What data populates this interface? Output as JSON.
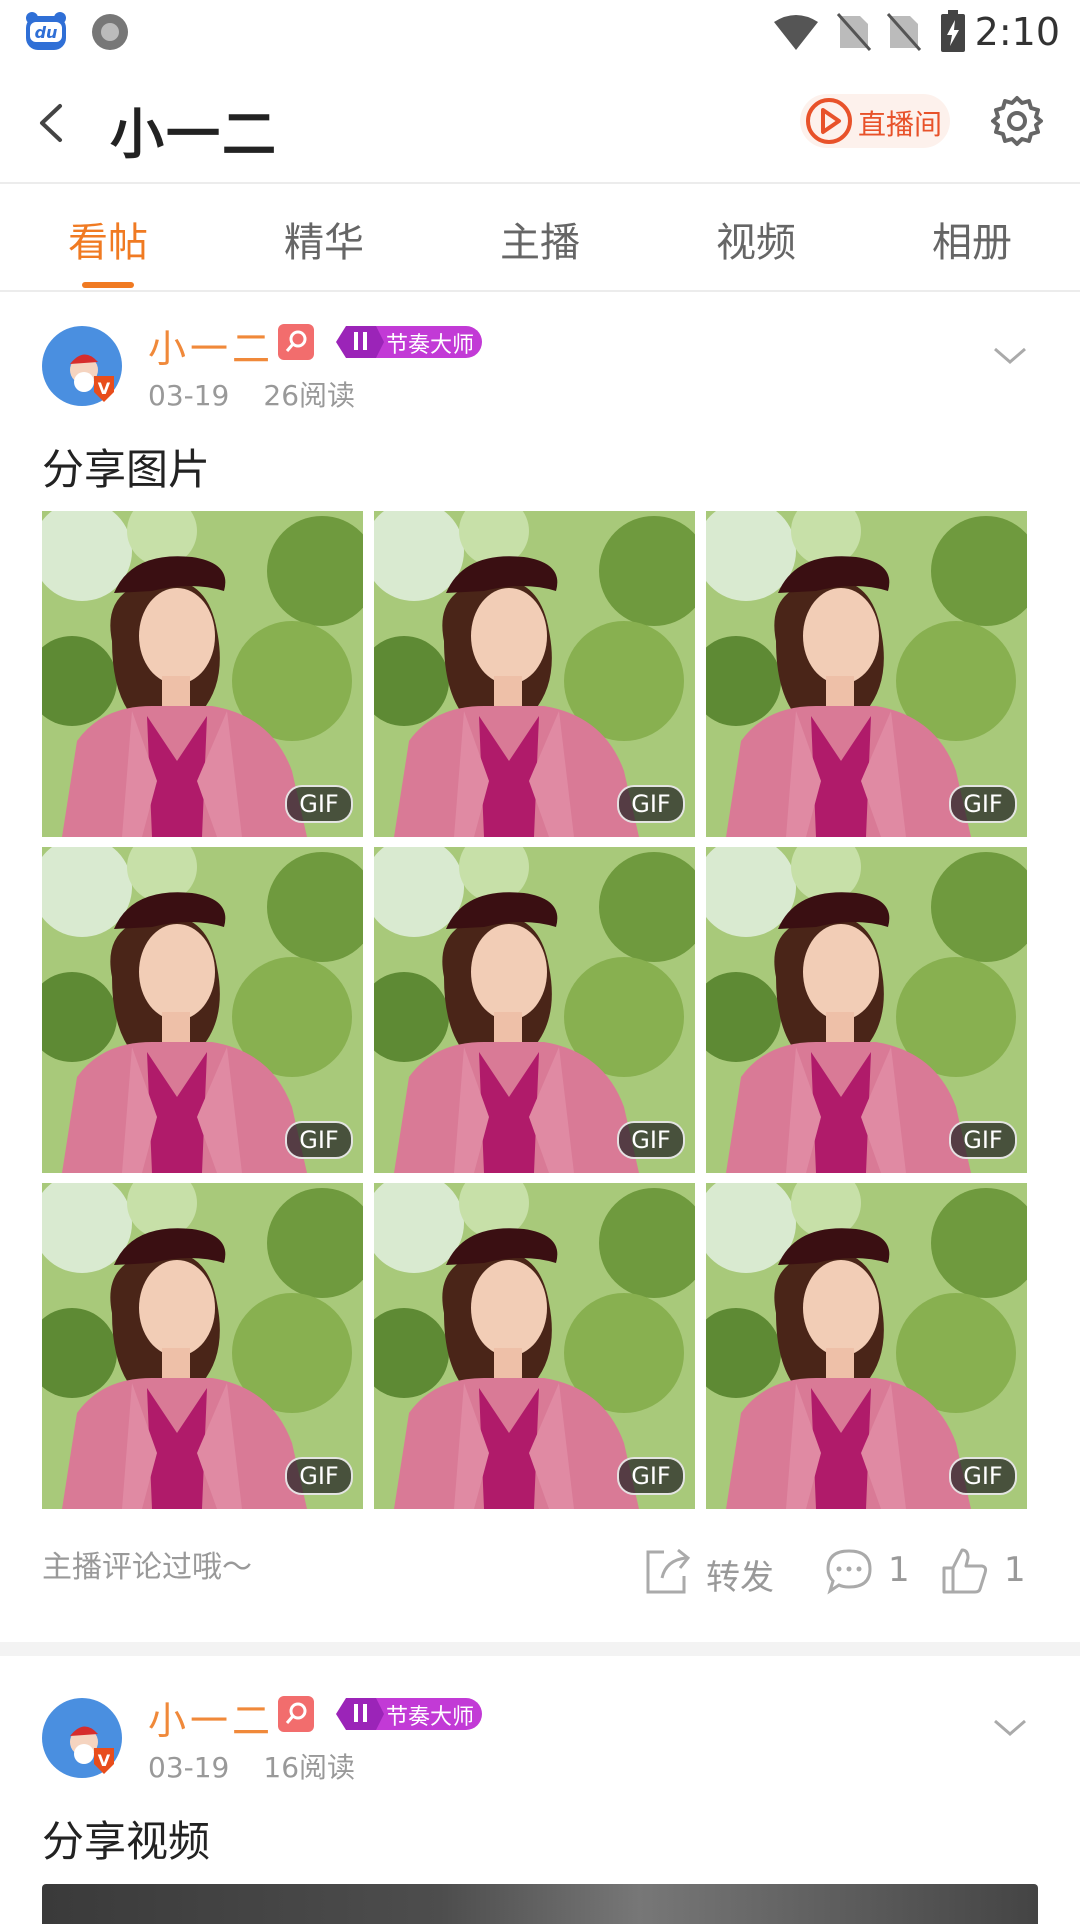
{
  "status_bar": {
    "time": "2:10"
  },
  "header": {
    "title": "小一二",
    "live_button": "直播间"
  },
  "tabs": [
    "看帖",
    "精华",
    "主播",
    "视频",
    "相册"
  ],
  "active_tab": 0,
  "colors": {
    "accent": "#f07a22",
    "username": "#f0893a",
    "live": "#e8522a",
    "level_badge": "#c23ad6"
  },
  "posts": [
    {
      "username": "小一二",
      "level_badge": "节奏大师",
      "date": "03-19",
      "reads": "26阅读",
      "title": "分享图片",
      "image_badge": "GIF",
      "image_count": 9,
      "note": "主播评论过哦～",
      "share_label": "转发",
      "comments": "1",
      "likes": "1"
    },
    {
      "username": "小一二",
      "level_badge": "节奏大师",
      "date": "03-19",
      "reads": "16阅读",
      "title": "分享视频"
    }
  ]
}
